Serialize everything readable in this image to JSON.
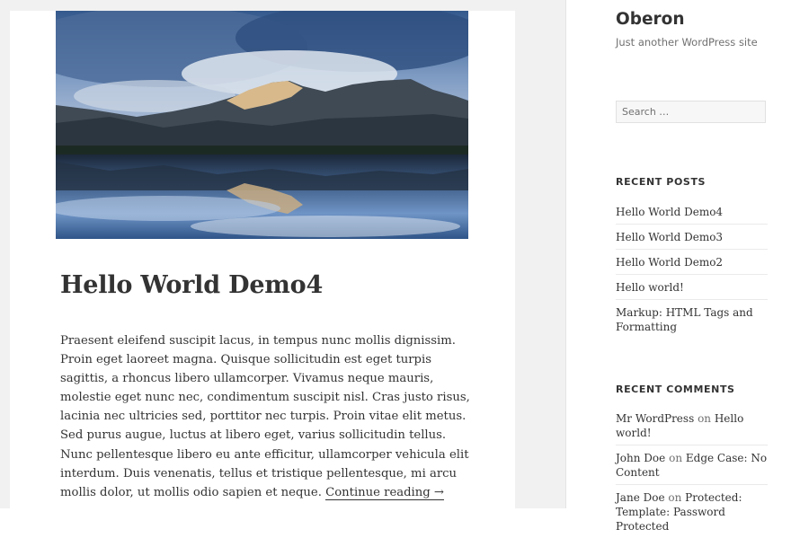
{
  "site": {
    "title": "Oberon",
    "tagline": "Just another WordPress site"
  },
  "search": {
    "placeholder": "Search …"
  },
  "post": {
    "title": "Hello World Demo4",
    "excerpt": "Praesent eleifend suscipit lacus, in tempus nunc mollis dignissim. Proin eget laoreet magna. Quisque sollicitudin est eget turpis sagittis, a rhoncus libero ullamcorper. Vivamus neque mauris, molestie eget nunc nec, condimentum suscipit nisl. Cras justo risus, lacinia nec ultricies sed, porttitor nec turpis. Proin vitae elit metus. Sed purus augue, luctus at libero eget, varius sollicitudin tellus. Nunc pellentesque libero eu ante efficitur, ullamcorper vehicula elit interdum. Duis venenatis, tellus et tristique pellentesque, mi arcu mollis dolor, ut mollis odio sapien et neque.",
    "continue_label": "Continue reading →",
    "image_icon": "mountain-lake-photo"
  },
  "recent_posts": {
    "heading": "RECENT POSTS",
    "items": [
      "Hello World Demo4",
      "Hello World Demo3",
      "Hello World Demo2",
      "Hello world!",
      "Markup: HTML Tags and Formatting"
    ]
  },
  "recent_comments": {
    "heading": "RECENT COMMENTS",
    "connector": "on",
    "items": [
      {
        "author": "Mr WordPress",
        "post": "Hello world!"
      },
      {
        "author": "John Doe",
        "post": "Edge Case: No Content"
      },
      {
        "author": "Jane Doe",
        "post": "Protected: Template: Password Protected"
      }
    ]
  }
}
